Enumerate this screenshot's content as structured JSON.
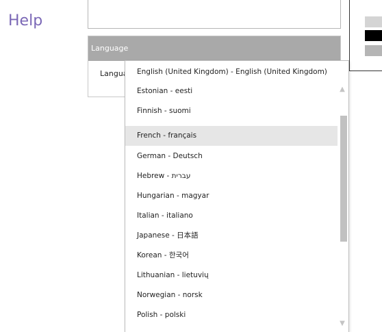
{
  "nav": {
    "help_label": "Help"
  },
  "language_section": {
    "header": "Language",
    "field_label": "Language"
  },
  "dropdown": {
    "current": "English (United Kingdom)  -  English (United Kingdom)",
    "options": [
      "Estonian  -  eesti",
      "Finnish  -  suomi",
      "French  -  français",
      "German  -  Deutsch",
      "Hebrew  -  עברית",
      "Hungarian  -  magyar",
      "Italian  -  italiano",
      "Japanese  -  日本語",
      "Korean  -  한국어",
      "Lithuanian  -  lietuvių",
      "Norwegian  -  norsk",
      "Polish  -  polski"
    ],
    "highlighted": "French  -  français",
    "scroll_up_icon": "arrow-up-icon",
    "scroll_down_icon": "arrow-down-icon"
  },
  "colors": {
    "accent": "#7b68b6",
    "section_header_bg": "#a9a9a9",
    "selected_bg": "#e6e6e6"
  }
}
